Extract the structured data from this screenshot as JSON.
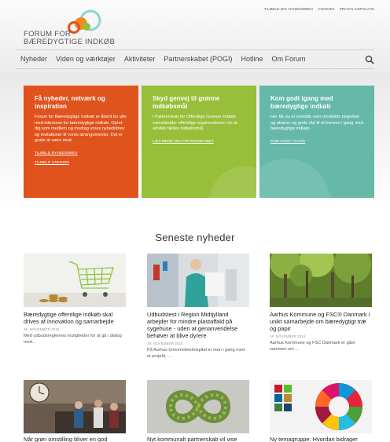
{
  "header": {
    "top_links": [
      "TILMELD DIG NYHEDSBREV",
      "COOKIES",
      "PRIVATLIVSPOLITIK"
    ],
    "logo_line1": "FORUM FOR",
    "logo_line2": "BÆREDYGTIGE INDKØB",
    "nav": [
      "Nyheder",
      "Viden og værktøjer",
      "Aktiviteter",
      "Partnerskabet (POGI)",
      "Hotline",
      "Om Forum"
    ],
    "search_icon": "search-icon"
  },
  "promos": [
    {
      "title": "Få nyheder, netværk og inspiration",
      "text": "Forum for Bæredygtige Indkøb er åbent for alle med interesse for bæredygtige indkøb. Opret dig som medlem og modtag vores nyhedsbrev og invitationer til vores arrangementer. Det er gratis at være med.",
      "links": [
        "TILMELD NYHEDSBREV",
        "TILMELD LINKEDIN"
      ],
      "color": "#e0531c"
    },
    {
      "title": "Skyd genvej til grønne indkøbsmål",
      "text": "I Partnerskab for Offentlige Grønne Indkøb samarbejder offentlige organisationer om at udvikle fælles indkøbsmål.",
      "links": [
        "LÆS MERE OM PARTNERSKABET"
      ],
      "color": "#97bf3a"
    },
    {
      "title": "Kom godt igang med bæredygtige indkøb",
      "text": "Her får du et overblik over områdets begreber og aktører og gode råd til at komme i gang med bæredygtige indkøb.",
      "links": [
        "KOM GODT I GANG"
      ],
      "color": "#66b9a8"
    }
  ],
  "news": {
    "heading": "Seneste nyheder",
    "items": [
      {
        "title": "Bæredygtige offentlige indkøb skal drives af innovation og samarbejde",
        "date": "26. NOVEMBER 2018",
        "excerpt": "Med udbudsreglernes muligheder for at gå i dialog med..."
      },
      {
        "title": "Udbudstest i Region Midtjylland arbejder for mindre plastaffald på sygehuse - uden at genanvendelse behøver at blive dyrere",
        "date": "19. NOVEMBER 2018",
        "excerpt": "På Aarhus Universitetshospital er man i gang med et projekt, ..."
      },
      {
        "title": "Aarhus Kommune og FSC® Danmark i unikt samarbejde om bæredygtigt træ og papir",
        "date": "18. NOVEMBER 2018",
        "excerpt": "Aarhus Kommune og FSC Danmark er gået sammen om ..."
      },
      {
        "title": "Når grøn omstilling bliver en god"
      },
      {
        "title": "Nyt kommunalt partnerskab vil vise"
      },
      {
        "title": "Ny temagruppe: Hvordan bidrager"
      }
    ]
  }
}
